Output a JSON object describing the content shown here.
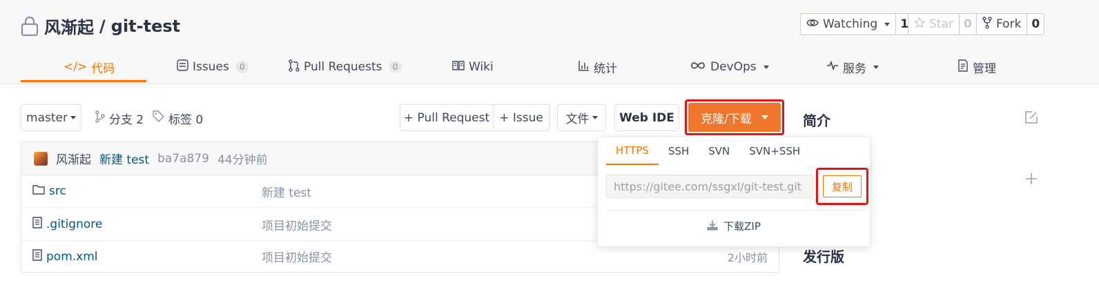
{
  "repo": {
    "owner": "风渐起",
    "separator": " / ",
    "name": "git-test"
  },
  "social": {
    "watch": {
      "label": "Watching",
      "count": "1"
    },
    "star": {
      "label": "Star",
      "count": "0"
    },
    "fork": {
      "label": "Fork",
      "count": "0"
    }
  },
  "tabs": [
    {
      "label": "代码",
      "icon": "code-icon",
      "active": true
    },
    {
      "label": "Issues",
      "icon": "issues-icon",
      "badge": "0"
    },
    {
      "label": "Pull Requests",
      "icon": "pull-request-icon",
      "badge": "0"
    },
    {
      "label": "Wiki",
      "icon": "wiki-icon"
    },
    {
      "label": "统计",
      "icon": "chart-icon"
    },
    {
      "label": "DevOps",
      "icon": "infinity-icon",
      "dropdown": true
    },
    {
      "label": "服务",
      "icon": "pulse-icon",
      "dropdown": true
    },
    {
      "label": "管理",
      "icon": "settings-doc-icon"
    }
  ],
  "toolbar": {
    "branch": "master",
    "branches": "分支 2",
    "tags": "标签 0",
    "pull_request": "+ Pull Request",
    "issue": "+ Issue",
    "file": "文件",
    "web_ide": "Web IDE",
    "clone": "克隆/下载"
  },
  "commit": {
    "author": "风渐起",
    "message": "新建 test",
    "hash": "ba7a879",
    "time": "44分钟前"
  },
  "files": [
    {
      "name": "src",
      "type": "folder",
      "message": "新建 test",
      "time": ""
    },
    {
      "name": ".gitignore",
      "type": "file",
      "message": "项目初始提交",
      "time": ""
    },
    {
      "name": "pom.xml",
      "type": "file",
      "message": "项目初始提交",
      "time": "2小时前"
    }
  ],
  "sidebar": {
    "intro": "简介",
    "releases": "发行版"
  },
  "clone_dropdown": {
    "tabs": [
      "HTTPS",
      "SSH",
      "SVN",
      "SVN+SSH"
    ],
    "active_tab": "HTTPS",
    "url": "https://gitee.com/ssgxl/git-test.git",
    "copy": "复制",
    "download_zip": "下载ZIP"
  },
  "colors": {
    "accent": "#fe7300",
    "clone_button": "#f0762c",
    "highlight_box": "#e81010",
    "link": "#005980"
  }
}
